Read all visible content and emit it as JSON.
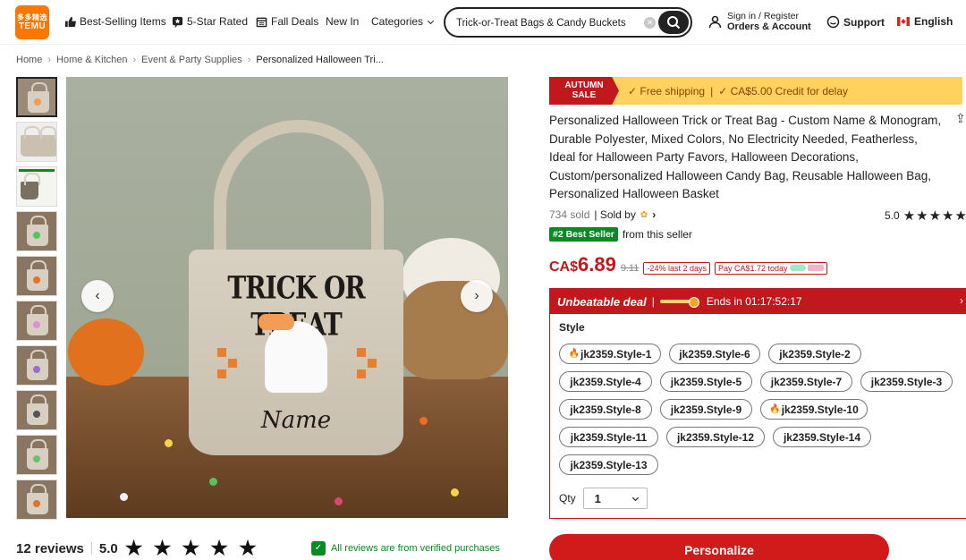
{
  "header": {
    "logo_line1": "多多精选",
    "logo_line2": "TEMU",
    "nav": [
      {
        "label": "Best-Selling Items",
        "icon": "thumbs-up-icon"
      },
      {
        "label": "5-Star Rated",
        "icon": "star-chat-icon"
      },
      {
        "label": "Fall Deals",
        "icon": "calendar-icon"
      },
      {
        "label": "New In",
        "icon": ""
      },
      {
        "label": "Categories",
        "icon": "chevron-down-icon"
      }
    ],
    "search_value": "Trick-or-Treat Bags & Candy Buckets",
    "account_line1": "Sign in / Register",
    "account_line2": "Orders & Account",
    "support": "Support",
    "language": "English"
  },
  "breadcrumb": [
    "Home",
    "Home & Kitchen",
    "Event & Party Supplies",
    "Personalized Halloween Tri..."
  ],
  "image": {
    "bag_text_top": "TRICK OR TREAT",
    "bag_text_bottom": "Name"
  },
  "reviews": {
    "count_label": "12 reviews",
    "score": "5.0",
    "stars": "★ ★ ★ ★ ★",
    "verified": "All reviews are from verified purchases"
  },
  "promo": {
    "tag_line1": "AUTUMN",
    "tag_line2": "SALE",
    "item1": "✓ Free shipping",
    "sep": "|",
    "item2": "✓ CA$5.00 Credit for delay"
  },
  "product": {
    "title": "Personalized Halloween Trick or Treat Bag - Custom Name & Monogram, Durable Polyester, Mixed Colors, No Electricity Needed, Featherless, Ideal for Halloween Party Favors, Halloween Decorations, Custom/personalized Halloween Candy Bag, Reusable Halloween Bag, Personalized Halloween Basket",
    "sold": "734 sold",
    "sold_by": "| Sold by",
    "rating": "5.0",
    "rating_stars": "★★★★★",
    "best_seller": "#2 Best Seller",
    "best_seller_suffix": "from this seller",
    "currency": "CA$",
    "price": "6.89",
    "old_price": "9.11",
    "discount": "-24% last 2 days",
    "pay_later": "Pay CA$1.72 today"
  },
  "deal": {
    "label": "Unbeatable deal",
    "ends": "Ends in 01:17:52:17",
    "style_label": "Style",
    "styles": [
      "jk2359.Style-1",
      "jk2359.Style-6",
      "jk2359.Style-2",
      "jk2359.Style-4",
      "jk2359.Style-5",
      "jk2359.Style-7",
      "jk2359.Style-3",
      "jk2359.Style-8",
      "jk2359.Style-9",
      "jk2359.Style-10",
      "jk2359.Style-11",
      "jk2359.Style-12",
      "jk2359.Style-14",
      "jk2359.Style-13"
    ],
    "qty_label": "Qty",
    "qty_value": "1"
  },
  "cta": "Personalize",
  "colors": {
    "brand": "#fb7701",
    "deal_red": "#c0181c",
    "promo_yellow": "#ffd15e",
    "verified_green": "#0a8a23"
  }
}
